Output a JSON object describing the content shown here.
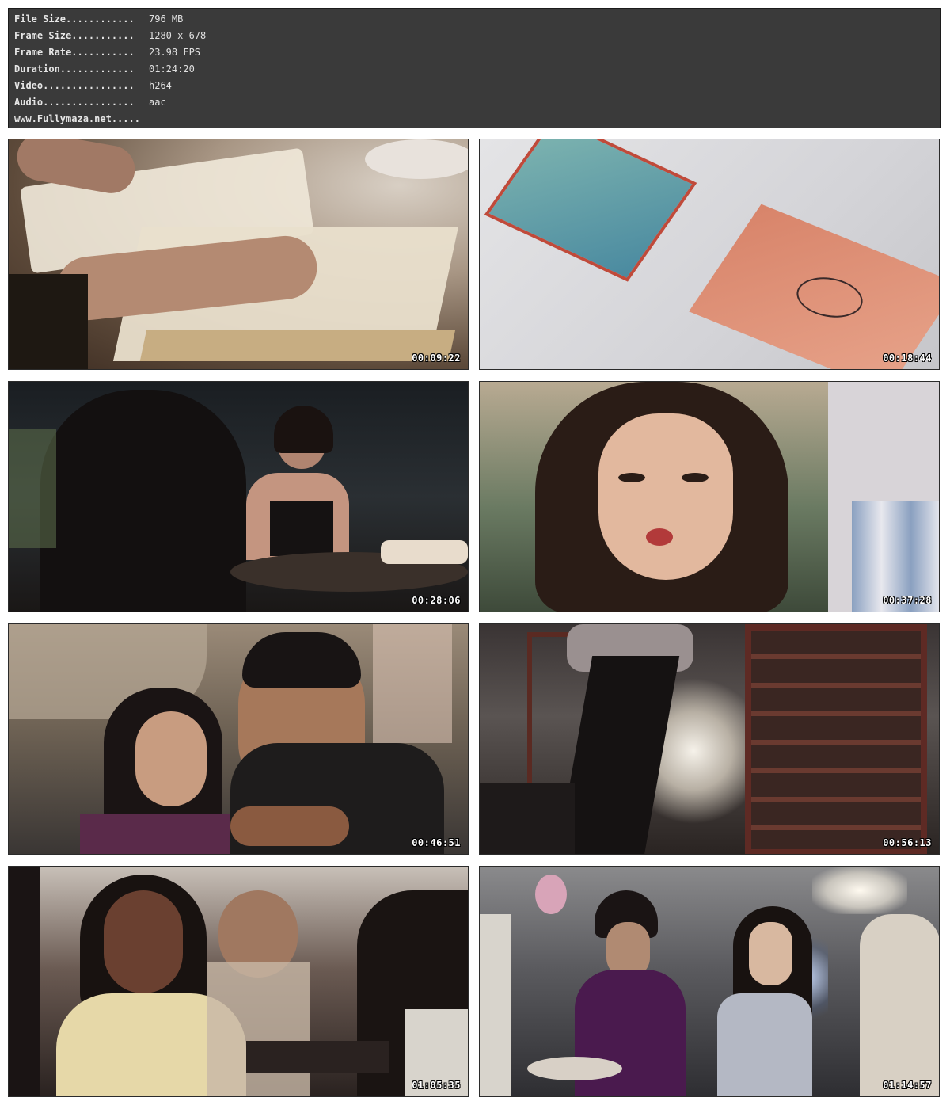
{
  "info": {
    "rows": [
      {
        "label": "File Size............",
        "value": "796 MB"
      },
      {
        "label": "Frame Size...........",
        "value": "1280 x 678"
      },
      {
        "label": "Frame Rate...........",
        "value": "23.98 FPS"
      },
      {
        "label": "Duration.............",
        "value": "01:24:20"
      },
      {
        "label": "Video................",
        "value": "h264"
      },
      {
        "label": "Audio................",
        "value": "aac"
      }
    ],
    "website": "www.Fullymaza.net....."
  },
  "thumbnails": [
    {
      "timestamp": "00:09:22"
    },
    {
      "timestamp": "00:18:44"
    },
    {
      "timestamp": "00:28:06"
    },
    {
      "timestamp": "00:37:28"
    },
    {
      "timestamp": "00:46:51"
    },
    {
      "timestamp": "00:56:13"
    },
    {
      "timestamp": "01:05:35"
    },
    {
      "timestamp": "01:14:57"
    }
  ]
}
